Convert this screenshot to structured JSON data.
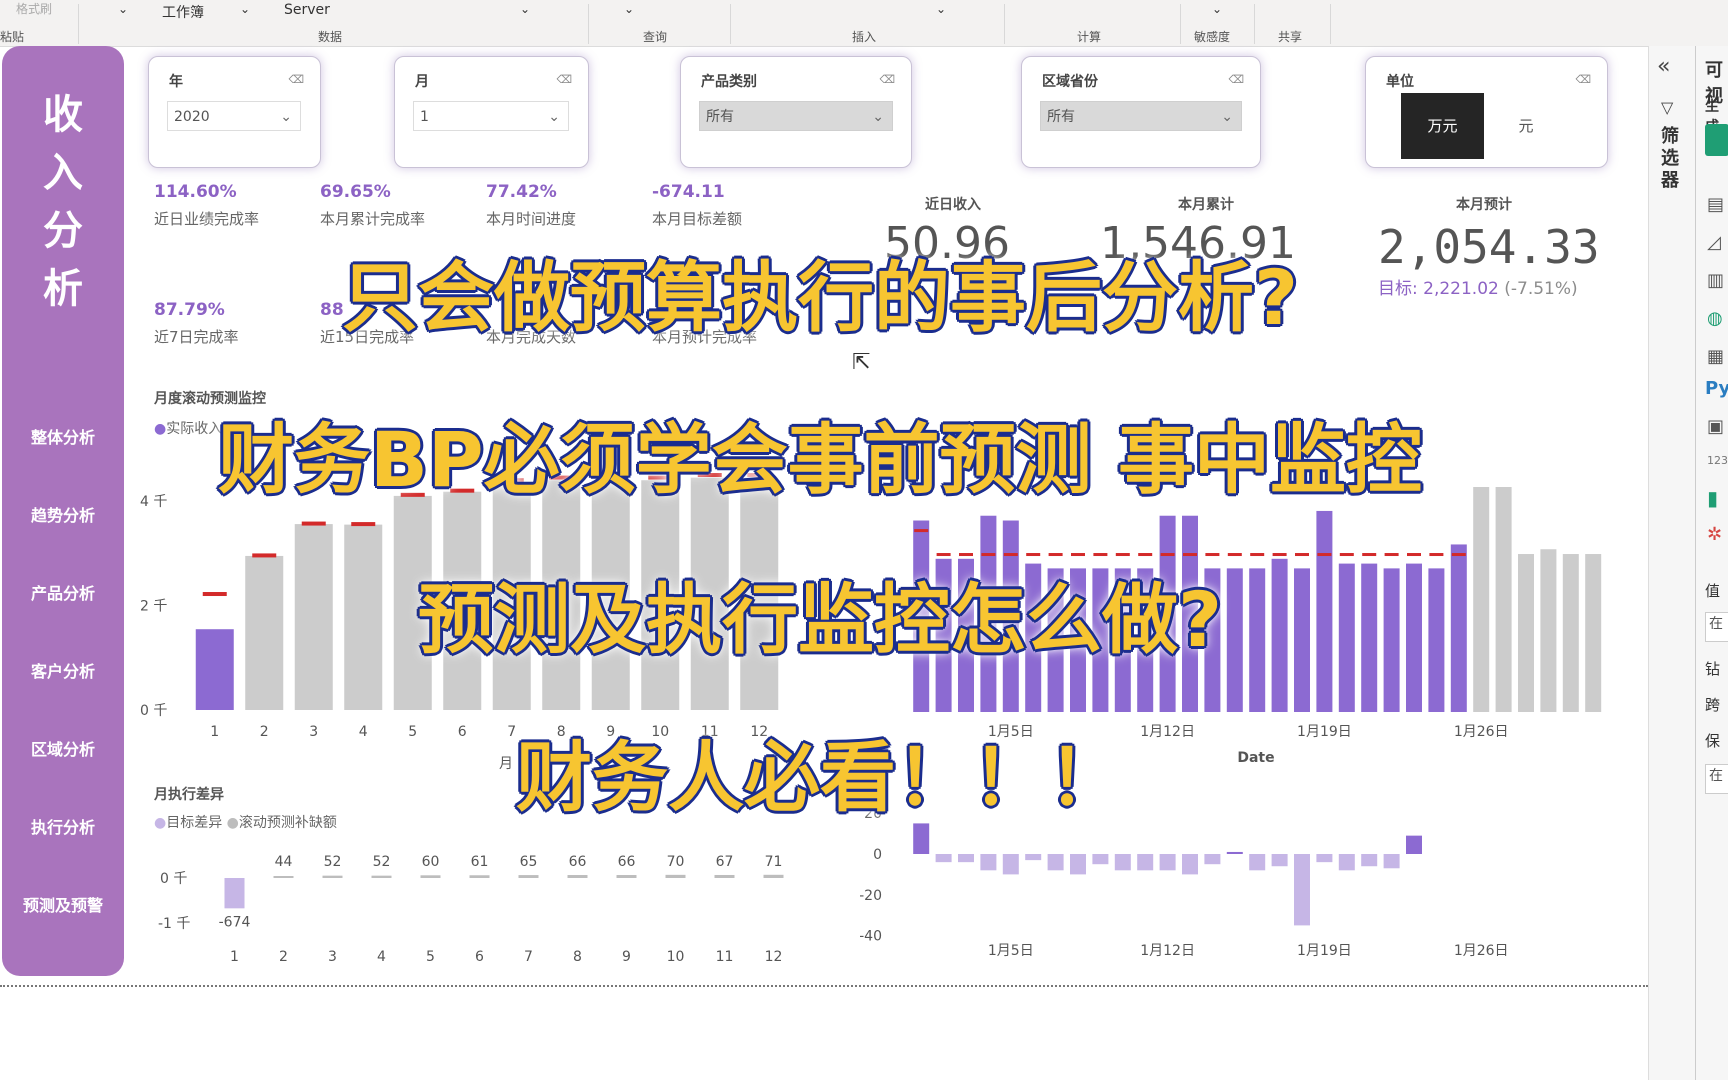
{
  "ribbon": {
    "items": [
      "格式刷",
      "工作簿",
      "Server"
    ],
    "groups": [
      "粘贴",
      "数据",
      "查询",
      "插入",
      "计算",
      "敏感度",
      "共享"
    ]
  },
  "nav": {
    "title": [
      "收",
      "入",
      "分",
      "析"
    ],
    "items": [
      "整体分析",
      "趋势分析",
      "产品分析",
      "客户分析",
      "区域分析",
      "执行分析",
      "预测及预警"
    ]
  },
  "slicers": {
    "year": {
      "label": "年",
      "value": "2020"
    },
    "month": {
      "label": "月",
      "value": "1"
    },
    "category": {
      "label": "产品类别",
      "value": "所有"
    },
    "region": {
      "label": "区域省份",
      "value": "所有"
    },
    "unit": {
      "label": "单位",
      "option_selected": "万元",
      "option_other": "元"
    }
  },
  "kpis": [
    {
      "value": "114.60%",
      "label": "近日业绩完成率"
    },
    {
      "value": "69.65%",
      "label": "本月累计完成率"
    },
    {
      "value": "77.42%",
      "label": "本月时间进度"
    },
    {
      "value": "-674.11",
      "label": "本月目标差额"
    },
    {
      "value": "87.79%",
      "label": "近7日完成率"
    },
    {
      "value": "88",
      "label": "近15日完成率"
    },
    {
      "value": "",
      "label": "本月完成天数"
    },
    {
      "value": "",
      "label": "本月预计完成率"
    }
  ],
  "cards": {
    "recent_income": {
      "label": "近日收入",
      "value": "50.96"
    },
    "month_cum": {
      "label": "本月累计",
      "value": "1,546.91"
    },
    "month_forecast": {
      "label": "本月预计",
      "value": "2,054.33",
      "target_text": "目标: 2,221.02",
      "delta": "(-7.51%)"
    }
  },
  "overlay": {
    "line1": "只会做预算执行的事后分析?",
    "line2": "财务BP必须学会事前预测 事中监控",
    "line3": "预测及执行监控怎么做?",
    "line4": "财务人必看！！！"
  },
  "section_titles": {
    "monthly_forecast": "月度滚动预测监控",
    "monthly_gap": "月执行差异"
  },
  "right_pane": {
    "filters": "筛选器",
    "visualizations_title": "可视",
    "build": "生成",
    "values": "值",
    "drill": "钻",
    "cross": "跨",
    "keep": "保",
    "on": "在"
  },
  "colors": {
    "nav_bg": "#a974bd",
    "actual": "#8c6ad2",
    "forecast": "#cccccc",
    "target_marker": "#d32a2a",
    "kpi_text": "#8c62c4",
    "overlay_fill": "#f7c531",
    "overlay_stroke": "#1b2d8e"
  },
  "chart_data": [
    {
      "type": "bar",
      "title": "月度滚动预测监控",
      "xlabel": "月",
      "legend": [
        "实际收入"
      ],
      "y_ticks": [
        "0 千",
        "2 千",
        "4 千"
      ],
      "ylim": [
        0,
        4500
      ],
      "categories": [
        "1",
        "2",
        "3",
        "4",
        "5",
        "6",
        "7",
        "8",
        "9",
        "10",
        "11",
        "12"
      ],
      "series": [
        {
          "name": "实际收入",
          "values": [
            1546.91,
            0,
            0,
            0,
            0,
            0,
            0,
            0,
            0,
            0,
            0,
            0
          ]
        },
        {
          "values": [
            0,
            2950,
            3560,
            3550,
            4100,
            4180,
            4350,
            4400,
            4400,
            4400,
            4450,
            4450
          ]
        },
        {
          "values": [
            2221.02,
            2960,
            3570,
            3560,
            4120,
            4200,
            4400,
            4450,
            4450,
            4450,
            4500,
            4500
          ]
        }
      ]
    },
    {
      "type": "bar",
      "xlabel": "Date",
      "x_ticks": [
        "1月5日",
        "1月12日",
        "1月19日",
        "1月26日"
      ],
      "ylim": [
        0,
        4.2
      ],
      "categories": [
        "1",
        "2",
        "3",
        "4",
        "5",
        "6",
        "7",
        "8",
        "9",
        "10",
        "11",
        "12",
        "13",
        "14",
        "15",
        "16",
        "17",
        "18",
        "19",
        "20",
        "21",
        "22",
        "23",
        "24",
        "25",
        "26",
        "27",
        "28",
        "29",
        "30",
        "31"
      ],
      "series": [
        {
          "values": [
            4.0,
            3.2,
            3.2,
            4.1,
            4.0,
            3.1,
            3.0,
            3.0,
            3.0,
            3.0,
            3.0,
            4.1,
            4.1,
            3.0,
            3.0,
            3.0,
            3.2,
            3.0,
            4.2,
            3.1,
            3.1,
            3.0,
            3.1,
            3.0,
            3.5,
            0,
            0,
            0,
            0,
            0,
            0
          ]
        },
        {
          "values": [
            0,
            0,
            0,
            0,
            0,
            0,
            0,
            0,
            0,
            0,
            0,
            0,
            0,
            0,
            0,
            0,
            0,
            0,
            0,
            0,
            0,
            0,
            0,
            0,
            0,
            4.7,
            4.7,
            3.3,
            3.4,
            3.3,
            3.3
          ]
        },
        {
          "values": [
            3.8,
            3.3,
            3.3,
            3.3,
            3.3,
            3.3,
            3.3,
            3.3,
            3.3,
            3.3,
            3.3,
            3.3,
            3.3,
            3.3,
            3.3,
            3.3,
            3.3,
            3.3,
            3.3,
            3.3,
            3.3,
            3.3,
            3.3,
            3.3,
            3.3,
            3.3,
            3.3,
            3.3,
            3.3,
            3.3,
            3.3
          ]
        }
      ]
    },
    {
      "type": "bar",
      "title": "月执行差异",
      "legend": [
        "目标差异",
        "滚动预测补缺额"
      ],
      "y_ticks": [
        "0 千",
        "-1 千"
      ],
      "ylim": [
        -1000,
        200
      ],
      "categories": [
        "1",
        "2",
        "3",
        "4",
        "5",
        "6",
        "7",
        "8",
        "9",
        "10",
        "11",
        "12"
      ],
      "series": [
        {
          "name": "目标差异",
          "values": [
            -674,
            0,
            0,
            0,
            0,
            0,
            0,
            0,
            0,
            0,
            0,
            0
          ]
        },
        {
          "name": "滚动预测补缺额",
          "values": [
            0,
            44,
            52,
            52,
            60,
            61,
            65,
            66,
            66,
            70,
            67,
            71
          ]
        }
      ],
      "data_labels": [
        "-674",
        "44",
        "52",
        "52",
        "60",
        "61",
        "65",
        "66",
        "66",
        "70",
        "67",
        "71"
      ]
    },
    {
      "type": "bar",
      "x_ticks": [
        "1月5日",
        "1月12日",
        "1月19日",
        "1月26日"
      ],
      "y_ticks": [
        "20",
        "0",
        "-20",
        "-40"
      ],
      "ylim": [
        -40,
        20
      ],
      "categories": [
        "1",
        "2",
        "3",
        "4",
        "5",
        "6",
        "7",
        "8",
        "9",
        "10",
        "11",
        "12",
        "13",
        "14",
        "15",
        "16",
        "17",
        "18",
        "19",
        "20",
        "21",
        "22",
        "23",
        "24",
        "25"
      ],
      "series": [
        {
          "values": [
            15,
            -4,
            -4,
            -8,
            -10,
            -3,
            -8,
            -10,
            -5,
            -8,
            -8,
            -8,
            -10,
            -5,
            1,
            -8,
            -6,
            -35,
            -4,
            -8,
            -6,
            -7,
            9,
            0,
            0
          ]
        }
      ]
    }
  ]
}
